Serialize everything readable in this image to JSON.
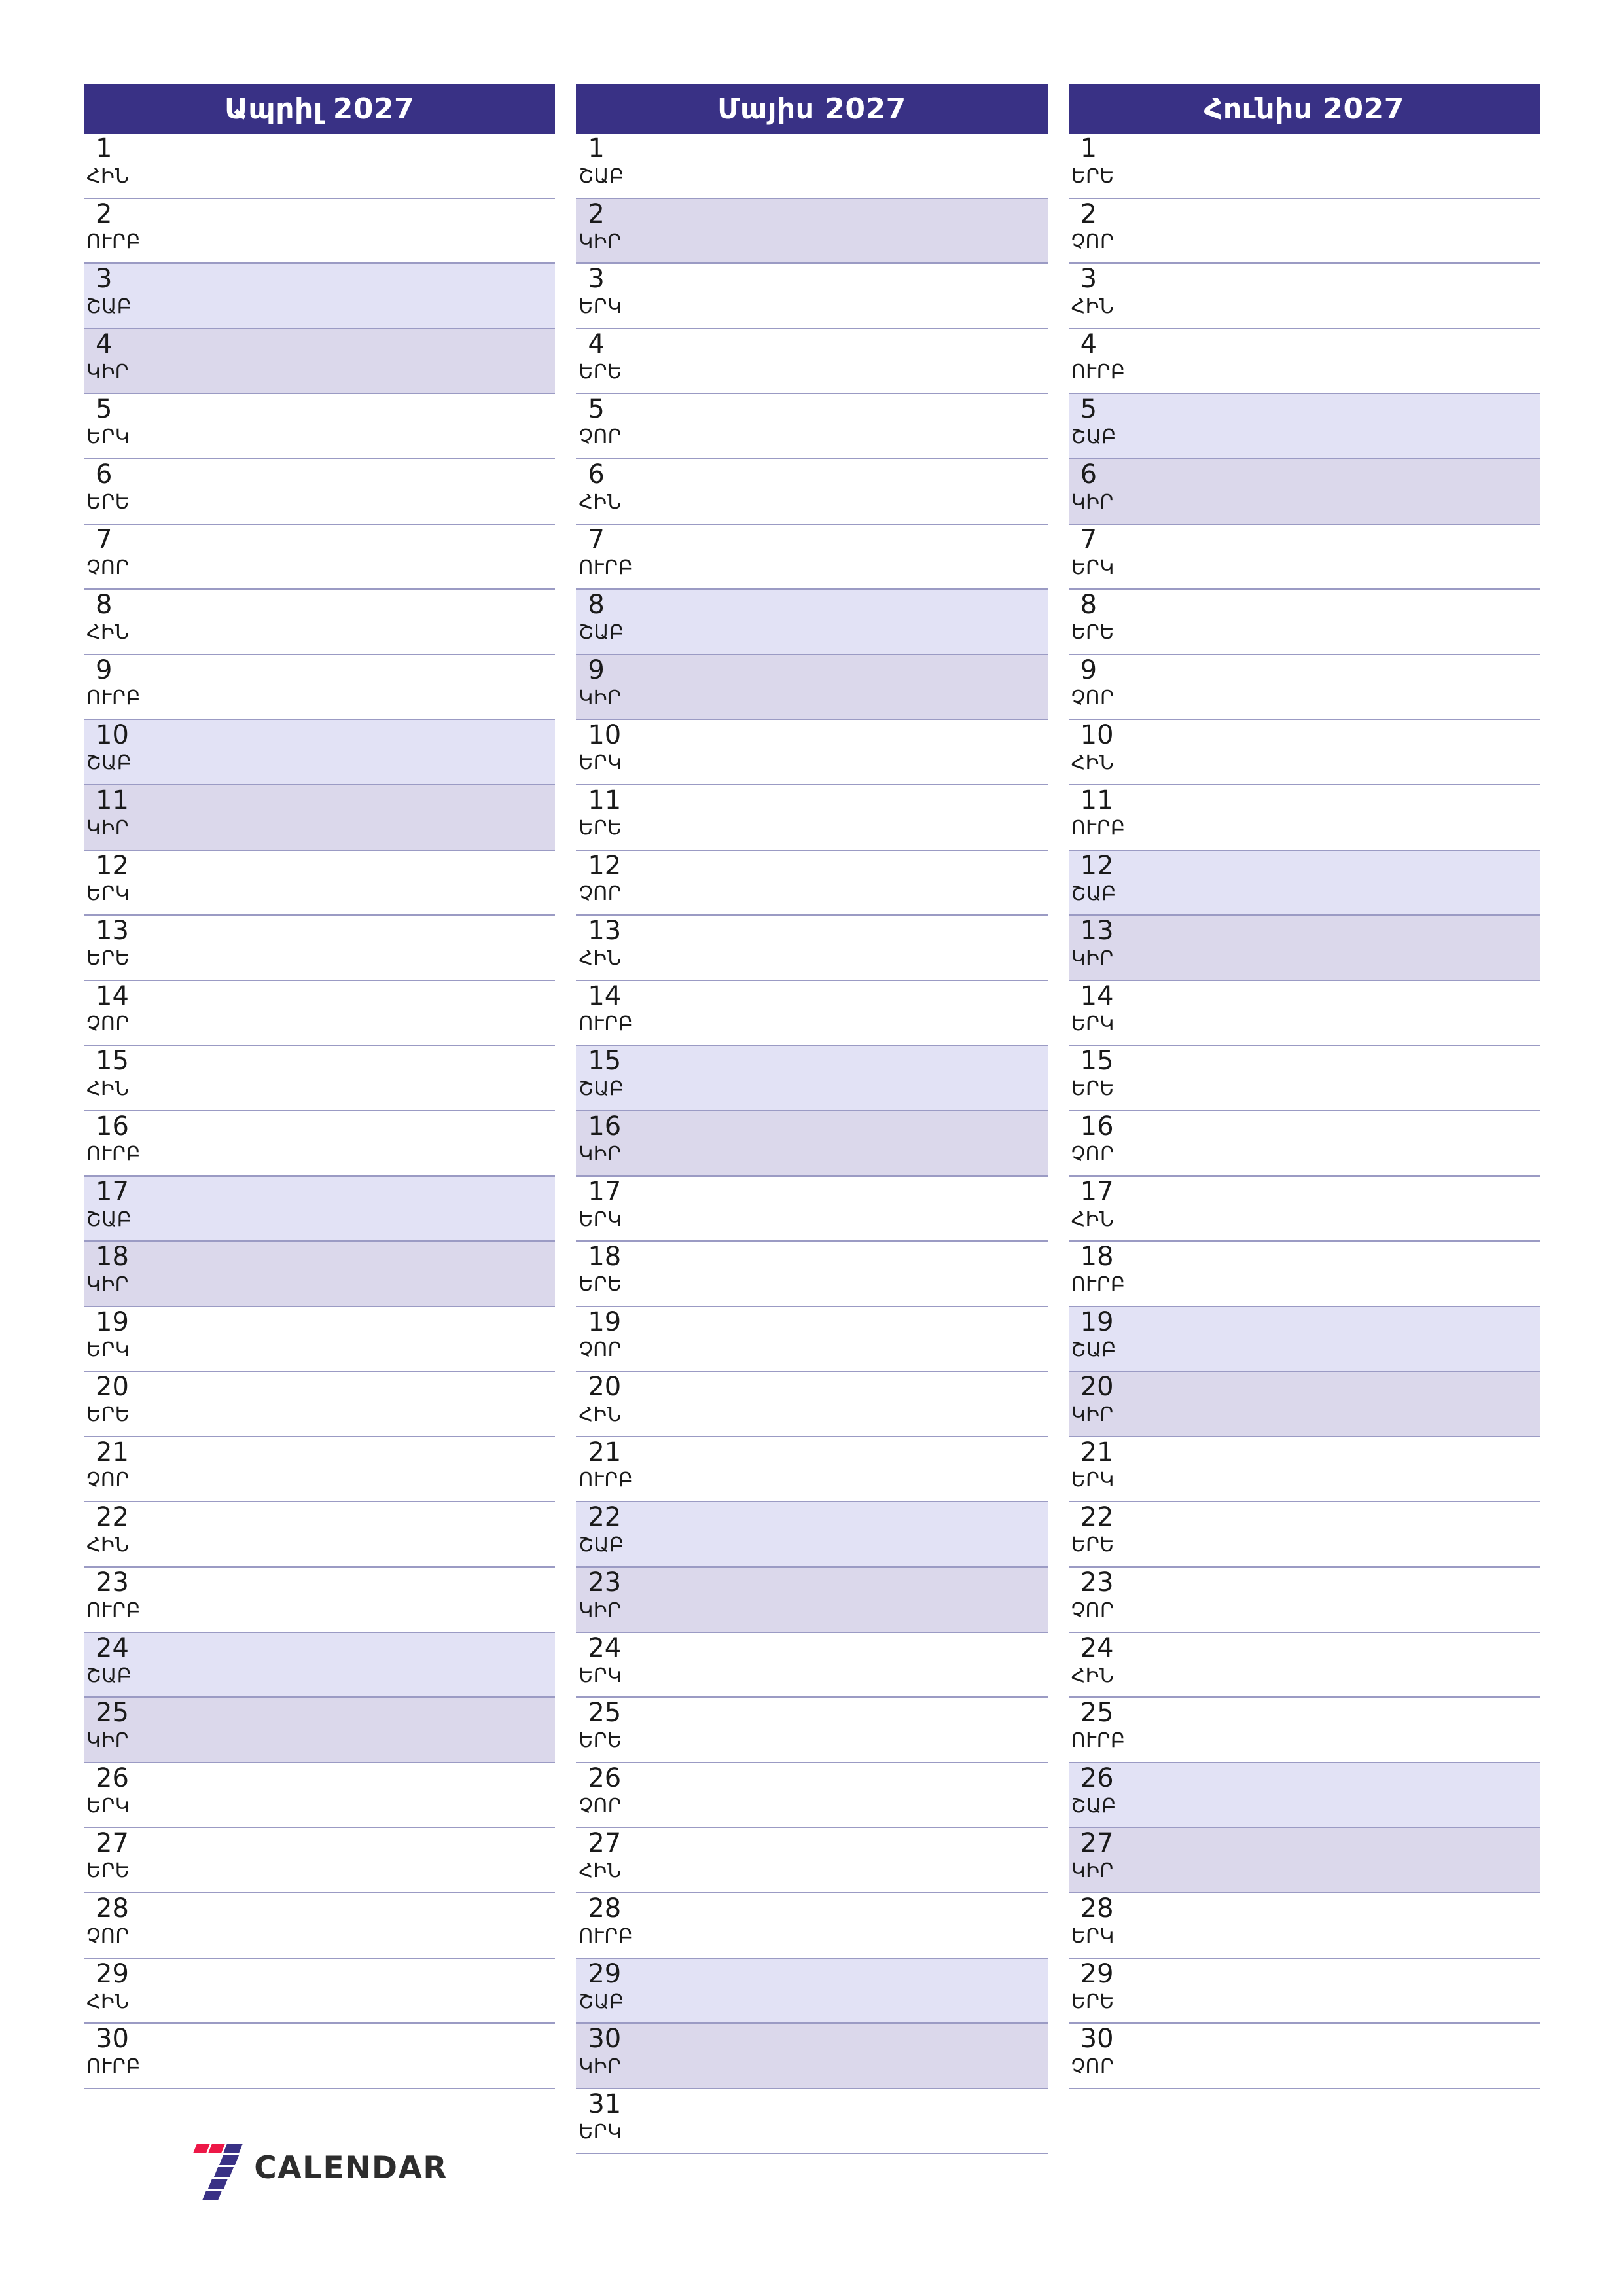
{
  "colors": {
    "header_bg": "#393185",
    "header_text": "#ffffff",
    "saturday_bg": "#e2e2f5",
    "sunday_bg": "#dbd8eb",
    "rule": "#9b9bc4",
    "logo_red": "#ed1847",
    "logo_purple": "#393185",
    "logo_text": "#2d2d2d"
  },
  "logo": {
    "text": "CALENDAR",
    "mark": "seven-stripes"
  },
  "weekday_names": {
    "mon": "ԵՐԿ",
    "tue": "ԵՐԵ",
    "wed": "ՉՈՐ",
    "thu": "ՀԻՆ",
    "fri": "ՈՒՐԲ",
    "sat": "ՇԱԲ",
    "sun": "ԿԻՐ"
  },
  "months": [
    {
      "title": "Ապրիլ 2027",
      "days": [
        {
          "n": "1",
          "w": "ՀԻՆ",
          "t": ""
        },
        {
          "n": "2",
          "w": "ՈՒՐԲ",
          "t": ""
        },
        {
          "n": "3",
          "w": "ՇԱԲ",
          "t": "sat"
        },
        {
          "n": "4",
          "w": "ԿԻՐ",
          "t": "sun"
        },
        {
          "n": "5",
          "w": "ԵՐԿ",
          "t": ""
        },
        {
          "n": "6",
          "w": "ԵՐԵ",
          "t": ""
        },
        {
          "n": "7",
          "w": "ՉՈՐ",
          "t": ""
        },
        {
          "n": "8",
          "w": "ՀԻՆ",
          "t": ""
        },
        {
          "n": "9",
          "w": "ՈՒՐԲ",
          "t": ""
        },
        {
          "n": "10",
          "w": "ՇԱԲ",
          "t": "sat"
        },
        {
          "n": "11",
          "w": "ԿԻՐ",
          "t": "sun"
        },
        {
          "n": "12",
          "w": "ԵՐԿ",
          "t": ""
        },
        {
          "n": "13",
          "w": "ԵՐԵ",
          "t": ""
        },
        {
          "n": "14",
          "w": "ՉՈՐ",
          "t": ""
        },
        {
          "n": "15",
          "w": "ՀԻՆ",
          "t": ""
        },
        {
          "n": "16",
          "w": "ՈՒՐԲ",
          "t": ""
        },
        {
          "n": "17",
          "w": "ՇԱԲ",
          "t": "sat"
        },
        {
          "n": "18",
          "w": "ԿԻՐ",
          "t": "sun"
        },
        {
          "n": "19",
          "w": "ԵՐԿ",
          "t": ""
        },
        {
          "n": "20",
          "w": "ԵՐԵ",
          "t": ""
        },
        {
          "n": "21",
          "w": "ՉՈՐ",
          "t": ""
        },
        {
          "n": "22",
          "w": "ՀԻՆ",
          "t": ""
        },
        {
          "n": "23",
          "w": "ՈՒՐԲ",
          "t": ""
        },
        {
          "n": "24",
          "w": "ՇԱԲ",
          "t": "sat"
        },
        {
          "n": "25",
          "w": "ԿԻՐ",
          "t": "sun"
        },
        {
          "n": "26",
          "w": "ԵՐԿ",
          "t": ""
        },
        {
          "n": "27",
          "w": "ԵՐԵ",
          "t": ""
        },
        {
          "n": "28",
          "w": "ՉՈՐ",
          "t": ""
        },
        {
          "n": "29",
          "w": "ՀԻՆ",
          "t": ""
        },
        {
          "n": "30",
          "w": "ՈՒՐԲ",
          "t": ""
        }
      ]
    },
    {
      "title": "Մայիս 2027",
      "days": [
        {
          "n": "1",
          "w": "ՇԱԲ",
          "t": ""
        },
        {
          "n": "2",
          "w": "ԿԻՐ",
          "t": "sun"
        },
        {
          "n": "3",
          "w": "ԵՐԿ",
          "t": ""
        },
        {
          "n": "4",
          "w": "ԵՐԵ",
          "t": ""
        },
        {
          "n": "5",
          "w": "ՉՈՐ",
          "t": ""
        },
        {
          "n": "6",
          "w": "ՀԻՆ",
          "t": ""
        },
        {
          "n": "7",
          "w": "ՈՒՐԲ",
          "t": ""
        },
        {
          "n": "8",
          "w": "ՇԱԲ",
          "t": "sat"
        },
        {
          "n": "9",
          "w": "ԿԻՐ",
          "t": "sun"
        },
        {
          "n": "10",
          "w": "ԵՐԿ",
          "t": ""
        },
        {
          "n": "11",
          "w": "ԵՐԵ",
          "t": ""
        },
        {
          "n": "12",
          "w": "ՉՈՐ",
          "t": ""
        },
        {
          "n": "13",
          "w": "ՀԻՆ",
          "t": ""
        },
        {
          "n": "14",
          "w": "ՈՒՐԲ",
          "t": ""
        },
        {
          "n": "15",
          "w": "ՇԱԲ",
          "t": "sat"
        },
        {
          "n": "16",
          "w": "ԿԻՐ",
          "t": "sun"
        },
        {
          "n": "17",
          "w": "ԵՐԿ",
          "t": ""
        },
        {
          "n": "18",
          "w": "ԵՐԵ",
          "t": ""
        },
        {
          "n": "19",
          "w": "ՉՈՐ",
          "t": ""
        },
        {
          "n": "20",
          "w": "ՀԻՆ",
          "t": ""
        },
        {
          "n": "21",
          "w": "ՈՒՐԲ",
          "t": ""
        },
        {
          "n": "22",
          "w": "ՇԱԲ",
          "t": "sat"
        },
        {
          "n": "23",
          "w": "ԿԻՐ",
          "t": "sun"
        },
        {
          "n": "24",
          "w": "ԵՐԿ",
          "t": ""
        },
        {
          "n": "25",
          "w": "ԵՐԵ",
          "t": ""
        },
        {
          "n": "26",
          "w": "ՉՈՐ",
          "t": ""
        },
        {
          "n": "27",
          "w": "ՀԻՆ",
          "t": ""
        },
        {
          "n": "28",
          "w": "ՈՒՐԲ",
          "t": ""
        },
        {
          "n": "29",
          "w": "ՇԱԲ",
          "t": "sat"
        },
        {
          "n": "30",
          "w": "ԿԻՐ",
          "t": "sun"
        },
        {
          "n": "31",
          "w": "ԵՐԿ",
          "t": ""
        }
      ]
    },
    {
      "title": "Հունիս 2027",
      "days": [
        {
          "n": "1",
          "w": "ԵՐԵ",
          "t": ""
        },
        {
          "n": "2",
          "w": "ՉՈՐ",
          "t": ""
        },
        {
          "n": "3",
          "w": "ՀԻՆ",
          "t": ""
        },
        {
          "n": "4",
          "w": "ՈՒՐԲ",
          "t": ""
        },
        {
          "n": "5",
          "w": "ՇԱԲ",
          "t": "sat"
        },
        {
          "n": "6",
          "w": "ԿԻՐ",
          "t": "sun"
        },
        {
          "n": "7",
          "w": "ԵՐԿ",
          "t": ""
        },
        {
          "n": "8",
          "w": "ԵՐԵ",
          "t": ""
        },
        {
          "n": "9",
          "w": "ՉՈՐ",
          "t": ""
        },
        {
          "n": "10",
          "w": "ՀԻՆ",
          "t": ""
        },
        {
          "n": "11",
          "w": "ՈՒՐԲ",
          "t": ""
        },
        {
          "n": "12",
          "w": "ՇԱԲ",
          "t": "sat"
        },
        {
          "n": "13",
          "w": "ԿԻՐ",
          "t": "sun"
        },
        {
          "n": "14",
          "w": "ԵՐԿ",
          "t": ""
        },
        {
          "n": "15",
          "w": "ԵՐԵ",
          "t": ""
        },
        {
          "n": "16",
          "w": "ՉՈՐ",
          "t": ""
        },
        {
          "n": "17",
          "w": "ՀԻՆ",
          "t": ""
        },
        {
          "n": "18",
          "w": "ՈՒՐԲ",
          "t": ""
        },
        {
          "n": "19",
          "w": "ՇԱԲ",
          "t": "sat"
        },
        {
          "n": "20",
          "w": "ԿԻՐ",
          "t": "sun"
        },
        {
          "n": "21",
          "w": "ԵՐԿ",
          "t": ""
        },
        {
          "n": "22",
          "w": "ԵՐԵ",
          "t": ""
        },
        {
          "n": "23",
          "w": "ՉՈՐ",
          "t": ""
        },
        {
          "n": "24",
          "w": "ՀԻՆ",
          "t": ""
        },
        {
          "n": "25",
          "w": "ՈՒՐԲ",
          "t": ""
        },
        {
          "n": "26",
          "w": "ՇԱԲ",
          "t": "sat"
        },
        {
          "n": "27",
          "w": "ԿԻՐ",
          "t": "sun"
        },
        {
          "n": "28",
          "w": "ԵՐԿ",
          "t": ""
        },
        {
          "n": "29",
          "w": "ԵՐԵ",
          "t": ""
        },
        {
          "n": "30",
          "w": "ՉՈՐ",
          "t": ""
        }
      ]
    }
  ]
}
